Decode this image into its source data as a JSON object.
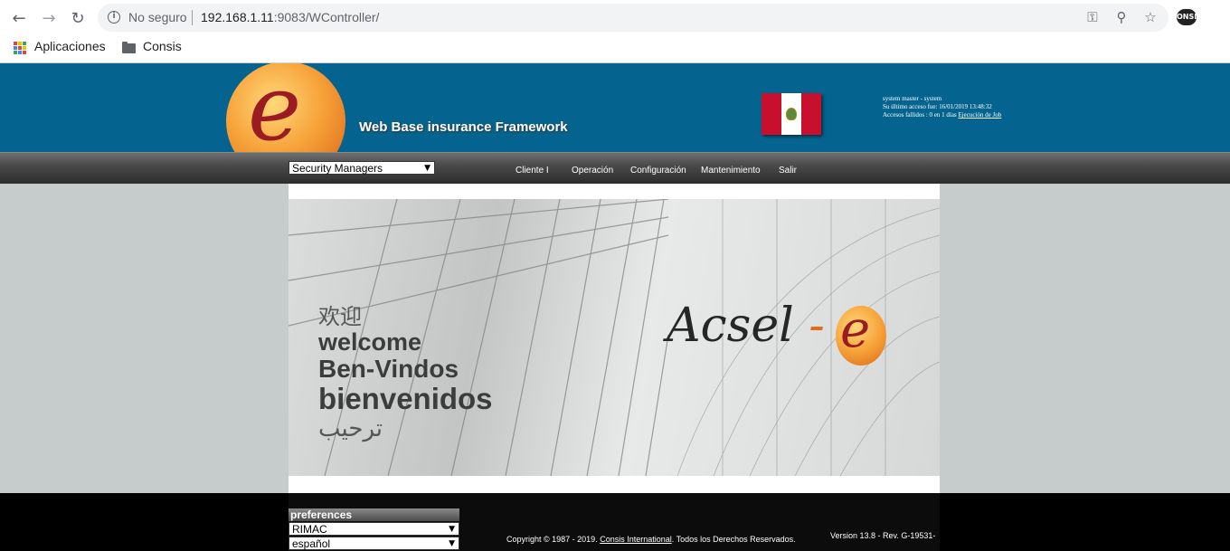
{
  "browser": {
    "security_label": "No seguro",
    "url_host": "192.168.1.11",
    "url_rest": ":9083/WController/",
    "bookmarks": [
      "Aplicaciones",
      "Consis"
    ],
    "extension_label": "ONSI"
  },
  "header": {
    "logo_letter": "e",
    "tagline": "Web Base insurance Framework",
    "user_line1": "system master - system",
    "user_line2": "Su último acceso fue: 16/01/2019 13:48:32",
    "user_line3": "Accesos fallidos : 0 en 1 días",
    "job_link": "Ejecución de Job"
  },
  "menu": {
    "module_select": "Security Managers",
    "items": [
      "Cliente I",
      "Operación",
      "Configuración",
      "Mantenimiento",
      "Salir"
    ]
  },
  "banner": {
    "greetings": [
      "欢迎",
      "welcome",
      "Ben-Vindos",
      "bienvenidos",
      "ترحيب"
    ],
    "brand_text": "Acsel",
    "brand_dash": "-",
    "brand_letter": "e"
  },
  "footer": {
    "prefs_title": "preferences",
    "company_select": "RIMAC",
    "language_select": "español",
    "copyright_prefix": "Copyright © 1987 - 2019.",
    "copyright_link": "Consis International",
    "copyright_suffix": ". Todos los Derechos Reservados.",
    "version": "Version 13.8 - Rev. G-19531-"
  },
  "colors": {
    "header_bg": "#05648f",
    "page_bg": "#c6cbcc",
    "footer_bg": "#000000"
  }
}
